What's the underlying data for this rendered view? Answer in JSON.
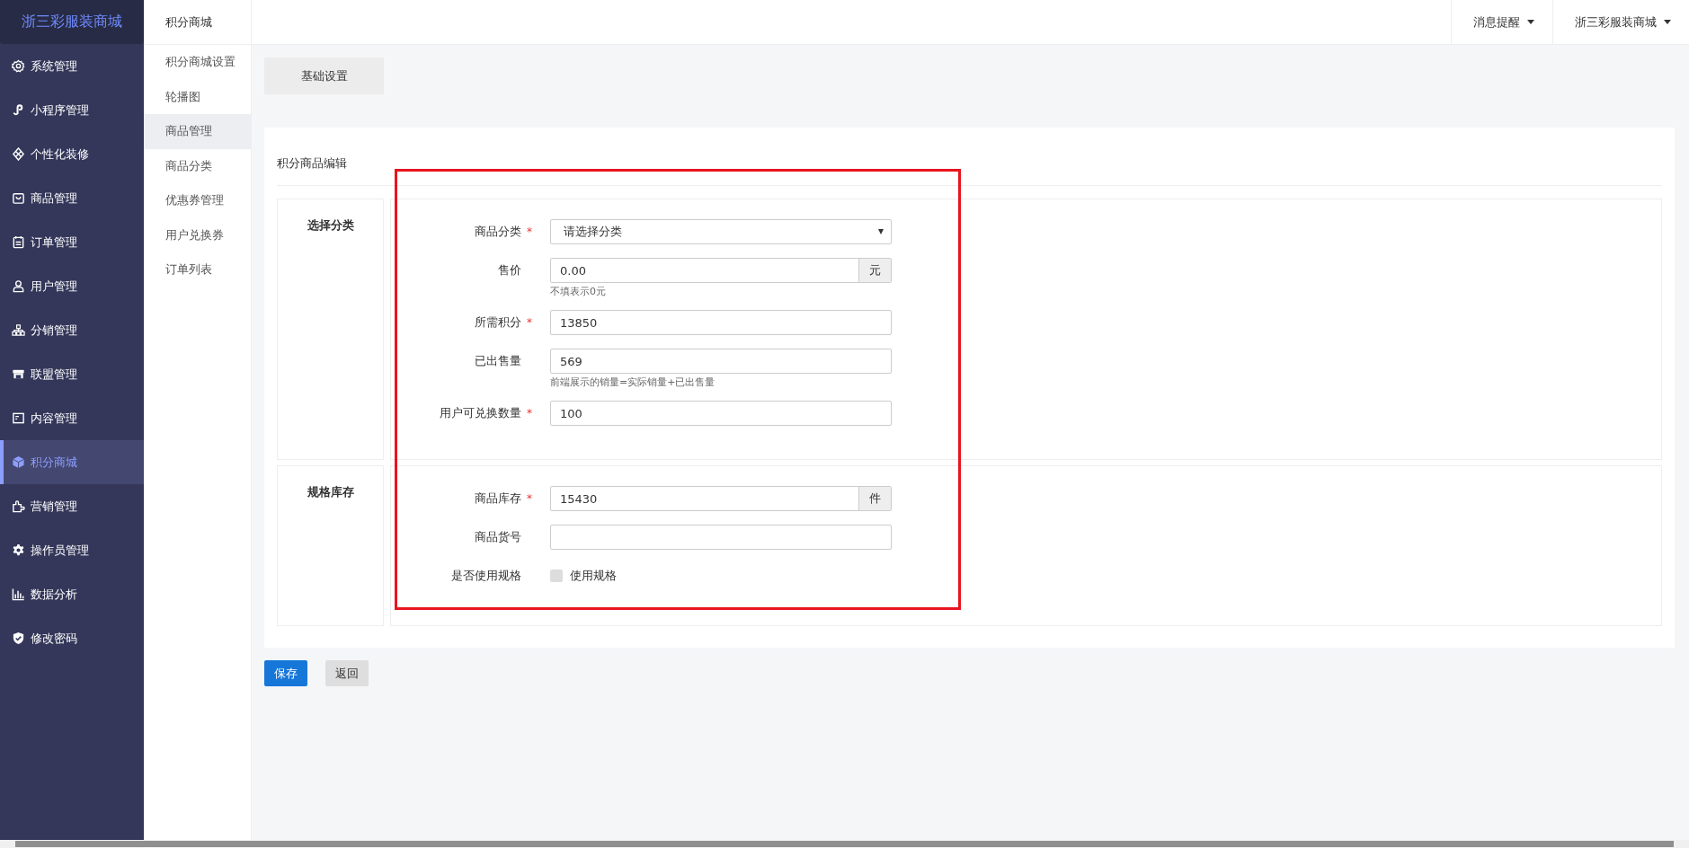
{
  "brand": "浙三彩服装商城",
  "sidebar": {
    "items": [
      {
        "label": "系统管理",
        "selected": false
      },
      {
        "label": "小程序管理",
        "selected": false
      },
      {
        "label": "个性化装修",
        "selected": false
      },
      {
        "label": "商品管理",
        "selected": false
      },
      {
        "label": "订单管理",
        "selected": false
      },
      {
        "label": "用户管理",
        "selected": false
      },
      {
        "label": "分销管理",
        "selected": false
      },
      {
        "label": "联盟管理",
        "selected": false
      },
      {
        "label": "内容管理",
        "selected": false
      },
      {
        "label": "积分商城",
        "selected": true
      },
      {
        "label": "营销管理",
        "selected": false
      },
      {
        "label": "操作员管理",
        "selected": false
      },
      {
        "label": "数据分析",
        "selected": false
      },
      {
        "label": "修改密码",
        "selected": false
      }
    ]
  },
  "submenu": {
    "title": "积分商城",
    "items": [
      {
        "label": "积分商城设置",
        "selected": false
      },
      {
        "label": "轮播图",
        "selected": false
      },
      {
        "label": "商品管理",
        "selected": true
      },
      {
        "label": "商品分类",
        "selected": false
      },
      {
        "label": "优惠券管理",
        "selected": false
      },
      {
        "label": "用户兑换券",
        "selected": false
      },
      {
        "label": "订单列表",
        "selected": false
      }
    ]
  },
  "top_bar": {
    "menus": [
      {
        "label": "消息提醒"
      },
      {
        "label": "浙三彩服装商城"
      }
    ]
  },
  "tabs": [
    {
      "label": "基础设置",
      "selected": true
    }
  ],
  "form": {
    "title": "积分商品编辑",
    "sections": [
      {
        "title": "选择分类",
        "fields": [
          {
            "kind": "select",
            "label": "商品分类",
            "required_mark": "*",
            "value": "请选择分类"
          },
          {
            "kind": "input",
            "label": "售价",
            "value": "0.00",
            "addon": "元",
            "hint": "不填表示0元"
          },
          {
            "kind": "input",
            "label": "所需积分",
            "required_mark": "*",
            "value": "13850"
          },
          {
            "kind": "input",
            "label": "已出售量",
            "value": "569",
            "hint": "前端展示的销量=实际销量+已出售量"
          },
          {
            "kind": "input",
            "label": "用户可兑换数量",
            "required_mark": "*",
            "value": "100"
          }
        ]
      },
      {
        "title": "规格库存",
        "fields": [
          {
            "kind": "input",
            "label": "商品库存",
            "required_mark": "*",
            "value": "15430",
            "addon": "件"
          },
          {
            "kind": "input",
            "label": "商品货号"
          },
          {
            "kind": "checkbox",
            "label": "是否使用规格",
            "option": "使用规格",
            "checked": false
          }
        ]
      }
    ]
  },
  "buttons": [
    {
      "label": "保存",
      "kind": "primary"
    },
    {
      "label": "返回",
      "kind": "default"
    }
  ]
}
